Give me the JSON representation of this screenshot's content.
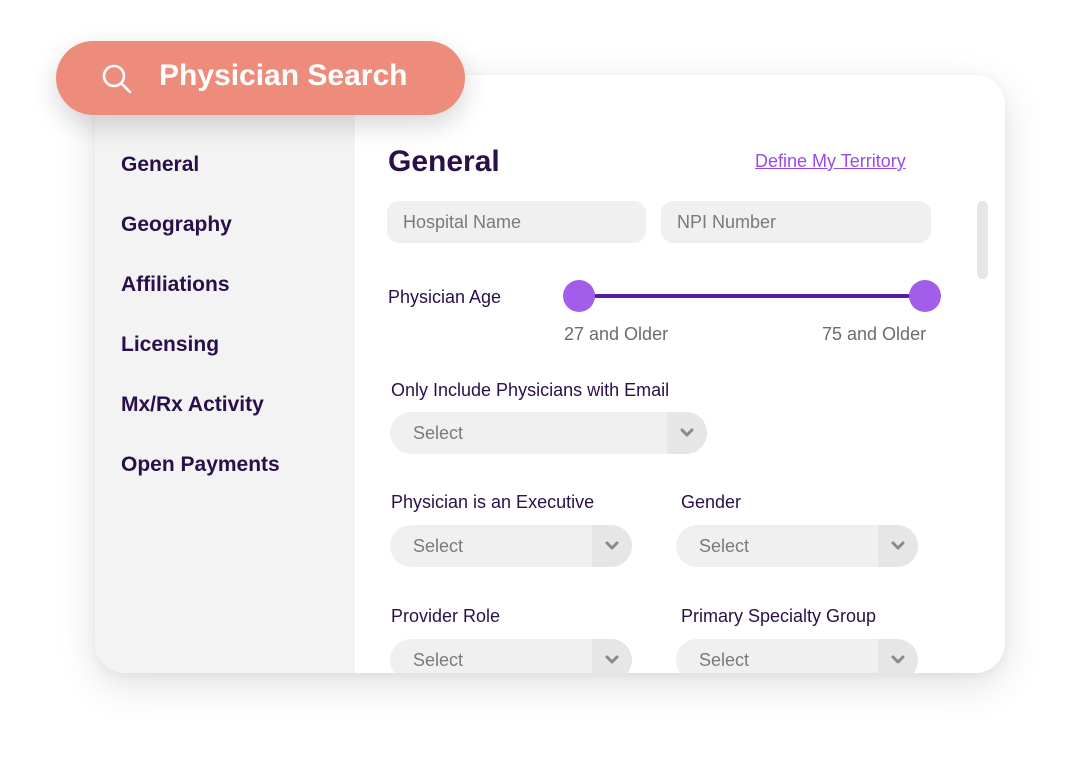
{
  "header": {
    "title": "Physician Search",
    "icon": "search-icon"
  },
  "sidebar": {
    "items": [
      {
        "label": "General"
      },
      {
        "label": "Geography"
      },
      {
        "label": "Affiliations"
      },
      {
        "label": "Licensing"
      },
      {
        "label": "Mx/Rx Activity"
      },
      {
        "label": "Open Payments"
      }
    ]
  },
  "main": {
    "title": "General",
    "territory_link": "Define My Territory",
    "hospital_placeholder": "Hospital Name",
    "npi_placeholder": "NPI Number",
    "age": {
      "label": "Physician Age",
      "min_label": "27 and Older",
      "max_label": "75 and Older"
    },
    "email_filter": {
      "label": "Only Include Physicians with Email",
      "value": "Select"
    },
    "executive_filter": {
      "label": "Physician is an Executive",
      "value": "Select"
    },
    "gender_filter": {
      "label": "Gender",
      "value": "Select"
    },
    "role_filter": {
      "label": "Provider Role",
      "value": "Select"
    },
    "specialty_filter": {
      "label": "Primary Specialty Group",
      "value": "Select"
    }
  },
  "colors": {
    "accent_pill": "#ee8c7c",
    "heading": "#2a0f4a",
    "link": "#9b4ae8",
    "slider_knob": "#a25ee8",
    "slider_track": "#5a1aa0"
  }
}
